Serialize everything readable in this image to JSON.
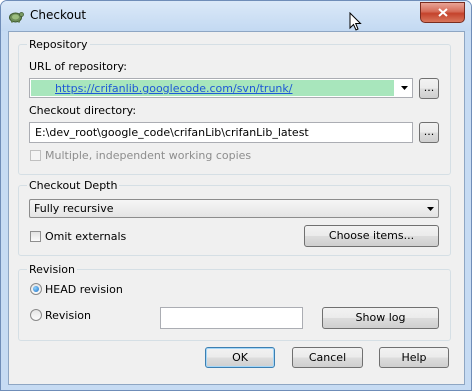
{
  "window": {
    "title": "Checkout",
    "close_label": "×"
  },
  "repository": {
    "group_label": "Repository",
    "url_label": "URL of repository:",
    "url_value": "https://crifanlib.googlecode.com/svn/trunk/",
    "url_browse_label": "...",
    "dir_label": "Checkout directory:",
    "dir_value": "E:\\dev_root\\google_code\\crifanLib\\crifanLib_latest",
    "dir_browse_label": "...",
    "multiple_label": "Multiple, independent working copies",
    "multiple_checked": false,
    "multiple_enabled": false
  },
  "depth": {
    "group_label": "Checkout Depth",
    "selected": "Fully recursive",
    "omit_externals_label": "Omit externals",
    "omit_externals_checked": false,
    "choose_items_label": "Choose items..."
  },
  "revision": {
    "group_label": "Revision",
    "head_label": "HEAD revision",
    "revision_label": "Revision",
    "selected_option": "HEAD revision",
    "revision_value": "",
    "show_log_label": "Show log"
  },
  "buttons": {
    "ok": "OK",
    "cancel": "Cancel",
    "help": "Help"
  },
  "colors": {
    "selection": "#a8e6bc",
    "link": "#1e58d6",
    "default_button_border": "#3c7fb1"
  },
  "icons": [
    "tortoise-svn-icon",
    "close-icon",
    "dropdown-arrow-icon",
    "mouse-cursor-icon"
  ]
}
